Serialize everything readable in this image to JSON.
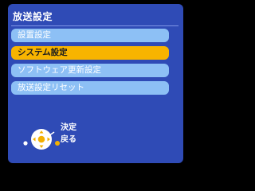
{
  "header": {
    "title": "放送設定"
  },
  "menu": {
    "items": [
      {
        "label": "設置設定",
        "selected": false
      },
      {
        "label": "システム設定",
        "selected": true
      },
      {
        "label": "ソフトウェア更新設定",
        "selected": false
      },
      {
        "label": "放送設定リセット",
        "selected": false
      }
    ]
  },
  "footer": {
    "confirm_label": "決定",
    "back_label": "戻る"
  },
  "colors": {
    "panel": "#2f4bb6",
    "item": "#8dc0f5",
    "selected": "#f8b400"
  },
  "icons": [
    "remote-dpad-icon",
    "yellow-dot-icon",
    "white-dot-icon"
  ]
}
